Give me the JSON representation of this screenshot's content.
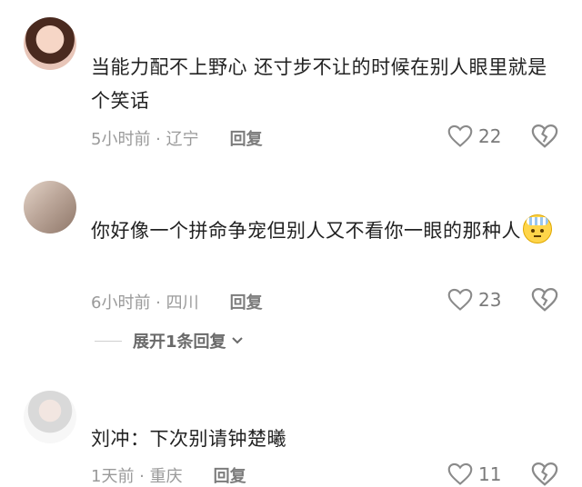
{
  "comments": [
    {
      "text": "当能力配不上野心 还寸步不让的时候在别人眼里就是个笑话",
      "time_location": "5小时前 · 辽宁",
      "reply_label": "回复",
      "likes": "22"
    },
    {
      "text": "你好像一个拼命争宠但别人又不看你一眼的那种人",
      "time_location": "6小时前 · 四川",
      "reply_label": "回复",
      "likes": "23",
      "expand_label": "展开1条回复"
    },
    {
      "text": "刘冲：下次别请钟楚曦",
      "time_location": "1天前 · 重庆",
      "reply_label": "回复",
      "likes": "11"
    }
  ],
  "icons": {
    "like": "heart-outline-icon",
    "dislike": "broken-heart-icon",
    "expand": "chevron-down-icon",
    "emoji": "mind-blown-emoji-icon"
  }
}
